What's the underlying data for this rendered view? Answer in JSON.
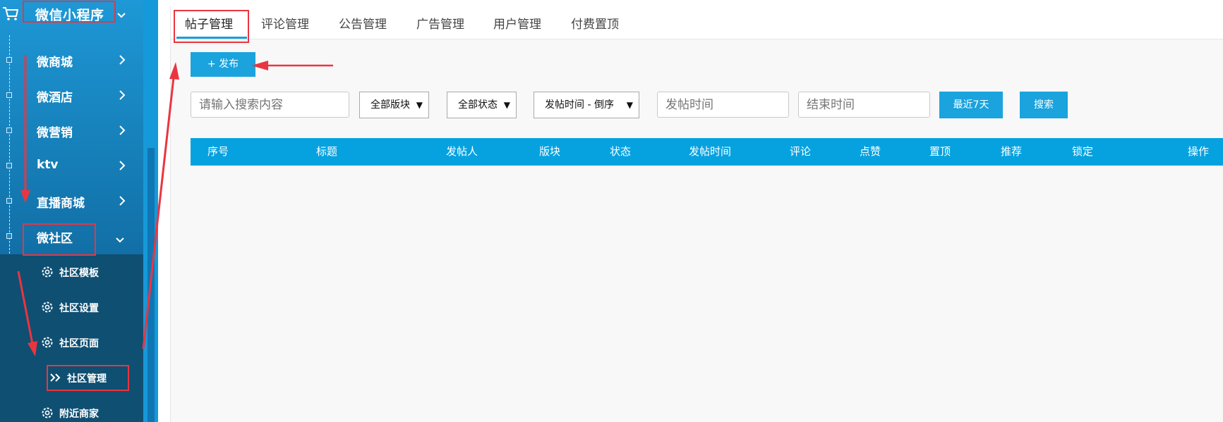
{
  "sidebar": {
    "title": "微信小程序",
    "items": [
      {
        "label": "微商城"
      },
      {
        "label": "微酒店"
      },
      {
        "label": "微营销"
      },
      {
        "label": "ktv"
      },
      {
        "label": "直播商城"
      },
      {
        "label": "微社区"
      }
    ],
    "sub_items": [
      {
        "label": "社区模板",
        "icon": "gear-icon"
      },
      {
        "label": "社区设置",
        "icon": "gear-icon"
      },
      {
        "label": "社区页面",
        "icon": "gear-icon"
      },
      {
        "label": "社区管理",
        "icon": "double-chevron-right-icon"
      },
      {
        "label": "附近商家",
        "icon": "gear-icon"
      }
    ]
  },
  "tabs": [
    {
      "label": "帖子管理"
    },
    {
      "label": "评论管理"
    },
    {
      "label": "公告管理"
    },
    {
      "label": "广告管理"
    },
    {
      "label": "用户管理"
    },
    {
      "label": "付费置顶"
    }
  ],
  "toolbar": {
    "publish_label": "+ 发布"
  },
  "filters": {
    "search_placeholder": "请输入搜索内容",
    "section_select": "全部版块",
    "status_select": "全部状态",
    "sort_select": "发帖时间 - 倒序",
    "start_time_placeholder": "发帖时间",
    "end_time_placeholder": "结束时间",
    "last7_label": "最近7天",
    "search_label": "搜索",
    "arrow_glyph": "▼"
  },
  "table": {
    "columns": [
      "序号",
      "标题",
      "发帖人",
      "版块",
      "状态",
      "发帖时间",
      "评论",
      "点赞",
      "置顶",
      "推荐",
      "锁定",
      "操作"
    ]
  },
  "colors": {
    "accent": "#1aa3dd",
    "table_header": "#06a2e0",
    "annotation": "#ea3540"
  }
}
